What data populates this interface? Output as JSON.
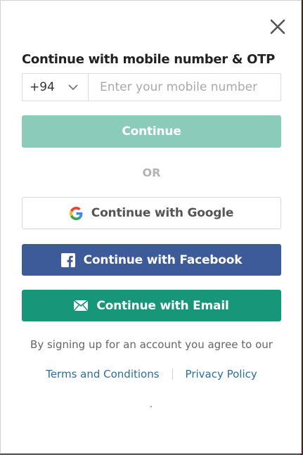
{
  "modal": {
    "heading": "Continue with mobile number & OTP",
    "country_code": "+94",
    "phone_placeholder": "Enter your mobile number",
    "continue_label": "Continue",
    "or_label": "OR",
    "google_label": "Continue with Google",
    "facebook_label": "Continue with Facebook",
    "email_label": "Continue with Email",
    "terms_text": "By signing up for an account you agree to our",
    "terms_link": "Terms and Conditions",
    "privacy_link": "Privacy Policy",
    "footer_dot": "."
  },
  "icons": {
    "close": "close-icon",
    "chevron": "chevron-down-icon",
    "google": "google-icon",
    "facebook": "facebook-icon",
    "email": "envelope-icon"
  },
  "colors": {
    "continue_disabled": "#8bcbb9",
    "facebook": "#3d5a99",
    "email": "#17967a",
    "link": "#2a6ea3"
  }
}
